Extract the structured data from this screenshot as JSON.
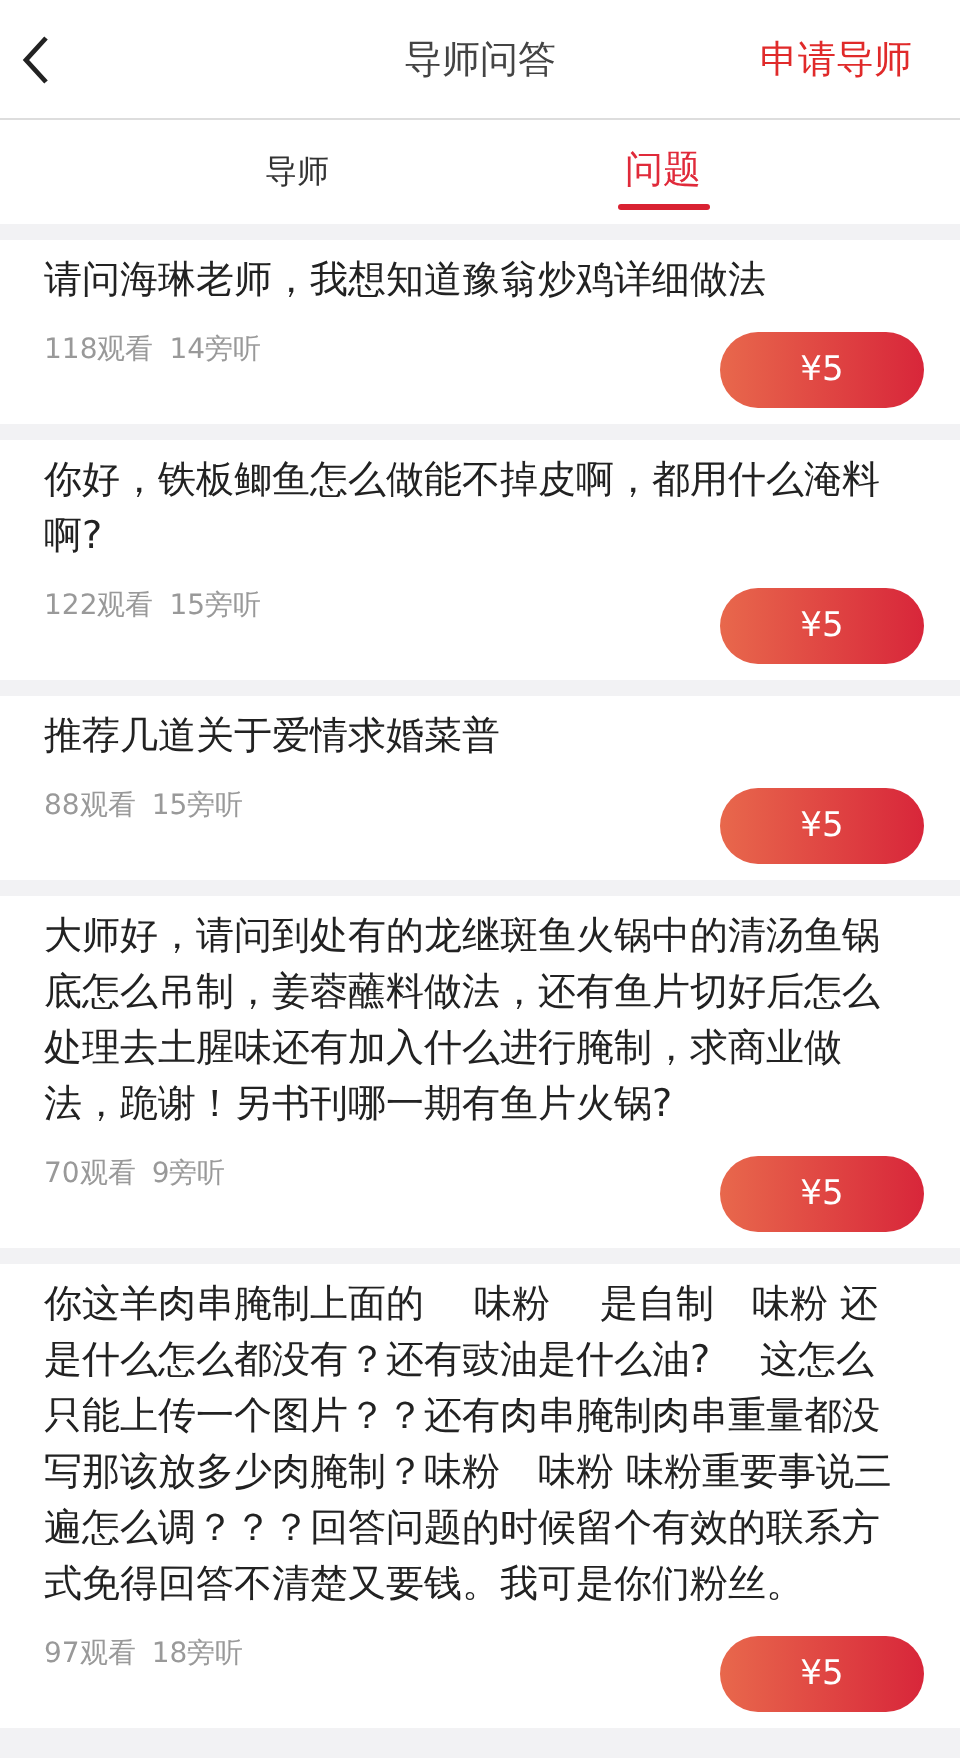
{
  "header": {
    "title": "导师问答",
    "action": "申请导师"
  },
  "tabs": [
    {
      "label": "导师",
      "selected": false
    },
    {
      "label": "问题",
      "selected": true
    }
  ],
  "questions": [
    {
      "text": "请问海琳老师，我想知道豫翁炒鸡详细做法",
      "views": "118观看",
      "listeners": "14旁听",
      "price": "¥5"
    },
    {
      "text": "你好，铁板鲫鱼怎么做能不掉皮啊，都用什么淹料啊?",
      "views": "122观看",
      "listeners": "15旁听",
      "price": "¥5"
    },
    {
      "text": "推荐几道关于爱情求婚菜普",
      "views": "88观看",
      "listeners": "15旁听",
      "price": "¥5"
    },
    {
      "text": "大师好，请问到处有的龙继斑鱼火锅中的清汤鱼锅底怎么吊制，姜蓉蘸料做法，还有鱼片切好后怎么处理去土腥味还有加入什么进行腌制，求商业做法，跪谢！另书刊哪一期有鱼片火锅?",
      "views": "70观看",
      "listeners": "9旁听",
      "price": "¥5"
    },
    {
      "text": "你这羊肉串腌制上面的　 味粉　 是自制　味粉 还是什么怎么都没有？还有豉油是什么油?　 这怎么只能上传一个图片？？还有肉串腌制肉串重量都没写那该放多少肉腌制？味粉　味粉 味粉重要事说三遍怎么调？？？回答问题的时候留个有效的联系方式免得回答不清楚又要钱。我可是你们粉丝。",
      "views": "97观看",
      "listeners": "18旁听",
      "price": "¥5"
    }
  ]
}
